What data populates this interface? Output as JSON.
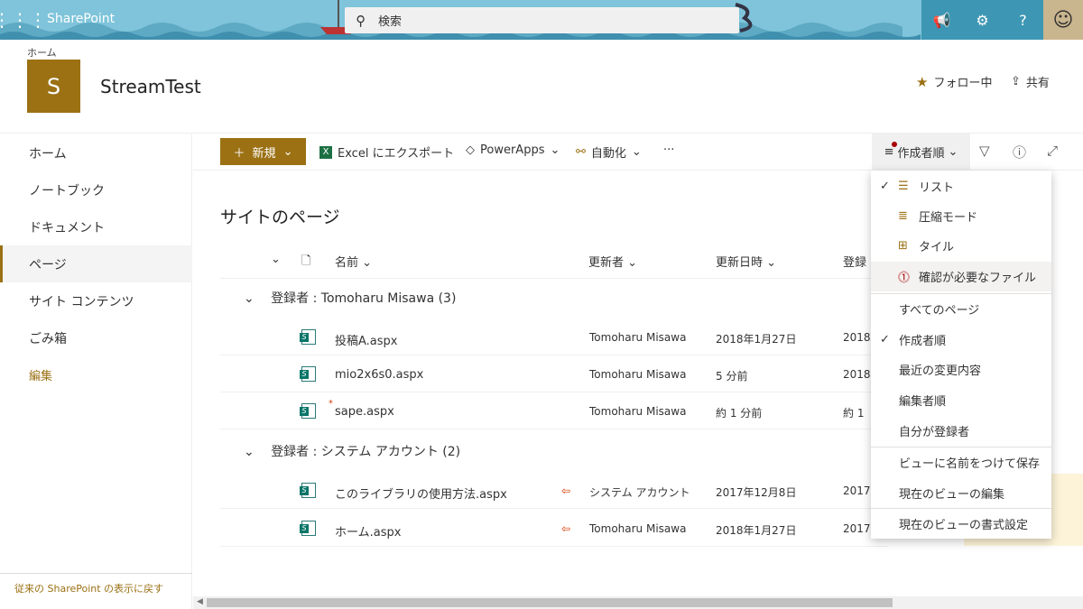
{
  "suite": {
    "app": "SharePoint",
    "search_placeholder": "検索"
  },
  "header": {
    "breadcrumb": "ホーム",
    "logo_letter": "S",
    "title": "StreamTest",
    "follow": "フォロー中",
    "share": "共有"
  },
  "nav": {
    "items": [
      "ホーム",
      "ノートブック",
      "ドキュメント",
      "ページ",
      "サイト コンテンツ",
      "ごみ箱"
    ],
    "edit": "編集",
    "classic": "従来の SharePoint の表示に戻す"
  },
  "cmd": {
    "new": "新規",
    "excel": "Excel にエクスポート",
    "powerapps": "PowerApps",
    "automate": "自動化",
    "more": "···",
    "sort": "作成者順"
  },
  "list": {
    "title": "サイトのページ",
    "columns": {
      "name": "名前",
      "modified_by": "更新者",
      "modified": "更新日時",
      "created_by": "登録"
    },
    "groups": [
      {
        "label": "登録者 : Tomoharu Misawa (3)",
        "rows": [
          {
            "name": "投稿A.aspx",
            "by": "Tomoharu Misawa",
            "date": "2018年1月27日",
            "c": "2018"
          },
          {
            "name": "mio2x6s0.aspx",
            "by": "Tomoharu Misawa",
            "date": "5 分前",
            "c": "2018"
          },
          {
            "name": "sape.aspx",
            "by": "Tomoharu Misawa",
            "date": "約 1 分前",
            "c": "約 1"
          }
        ]
      },
      {
        "label": "登録者 : システム アカウント (2)",
        "rows": [
          {
            "name": "このライブラリの使用方法.aspx",
            "by": "システム アカウント",
            "date": "2017年12月8日",
            "c": "2017"
          },
          {
            "name": "ホーム.aspx",
            "by": "Tomoharu Misawa",
            "date": "2018年1月27日",
            "c": "2017"
          }
        ]
      }
    ]
  },
  "menu": {
    "layouts": [
      "リスト",
      "圧縮モード",
      "タイル",
      "確認が必要なファイル"
    ],
    "views": [
      "すべてのページ",
      "作成者順",
      "最近の変更内容",
      "編集者順",
      "自分が登録者"
    ],
    "actions": [
      "ビューに名前をつけて保存",
      "現在のビューの編集",
      "現在のビューの書式設定"
    ]
  },
  "colors": {
    "accent": "#9b7114",
    "suite": "#6fb7cf"
  }
}
